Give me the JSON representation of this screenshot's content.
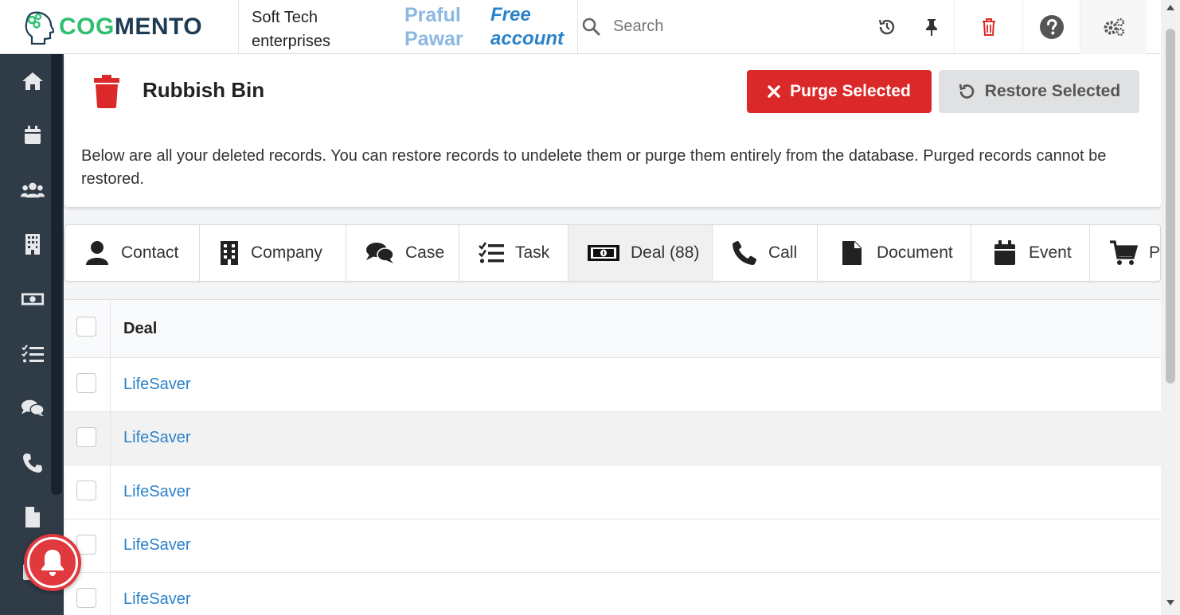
{
  "brand": {
    "logo_part1": "COG",
    "logo_part2": "MENTO"
  },
  "header": {
    "company_line1": "Soft Tech",
    "company_line2": "enterprises",
    "user_first": "Praful",
    "user_last": "Pawar",
    "account_line1": "Free",
    "account_line2": "account"
  },
  "search": {
    "placeholder": "Search"
  },
  "toolbar_icons": [
    "history-icon",
    "pin-icon",
    "trash-icon",
    "help-icon",
    "settings-icon"
  ],
  "sidebar_icons": [
    "home-icon",
    "calendar-icon",
    "contacts-icon",
    "companies-icon",
    "deals-icon",
    "tasks-icon",
    "cases-icon",
    "calls-icon",
    "documents-icon",
    "email-icon"
  ],
  "page": {
    "title": "Rubbish Bin",
    "purge_label": "Purge Selected",
    "restore_label": "Restore Selected",
    "info": "Below are all your deleted records. You can restore records to undelete them or purge them entirely from the database. Purged records cannot be restored."
  },
  "tabs": [
    {
      "label": "Contact",
      "icon": "user-icon"
    },
    {
      "label": "Company",
      "icon": "building-icon"
    },
    {
      "label": "Case",
      "icon": "comments-icon"
    },
    {
      "label": "Task",
      "icon": "tasks-icon"
    },
    {
      "label": "Deal (88)",
      "icon": "money-icon",
      "active": true
    },
    {
      "label": "Call",
      "icon": "phone-icon"
    },
    {
      "label": "Document",
      "icon": "file-icon"
    },
    {
      "label": "Event",
      "icon": "calendar-icon"
    },
    {
      "label": "Pr",
      "icon": "cart-icon"
    }
  ],
  "table": {
    "header": "Deal",
    "rows": [
      "LifeSaver",
      "LifeSaver",
      "LifeSaver",
      "LifeSaver",
      "LifeSaver"
    ]
  },
  "colors": {
    "sidebar": "#2f3b47",
    "purge": "#db2828",
    "link": "#2c82c9",
    "logo_green": "#2fbf71",
    "logo_dark": "#1d3b53"
  }
}
